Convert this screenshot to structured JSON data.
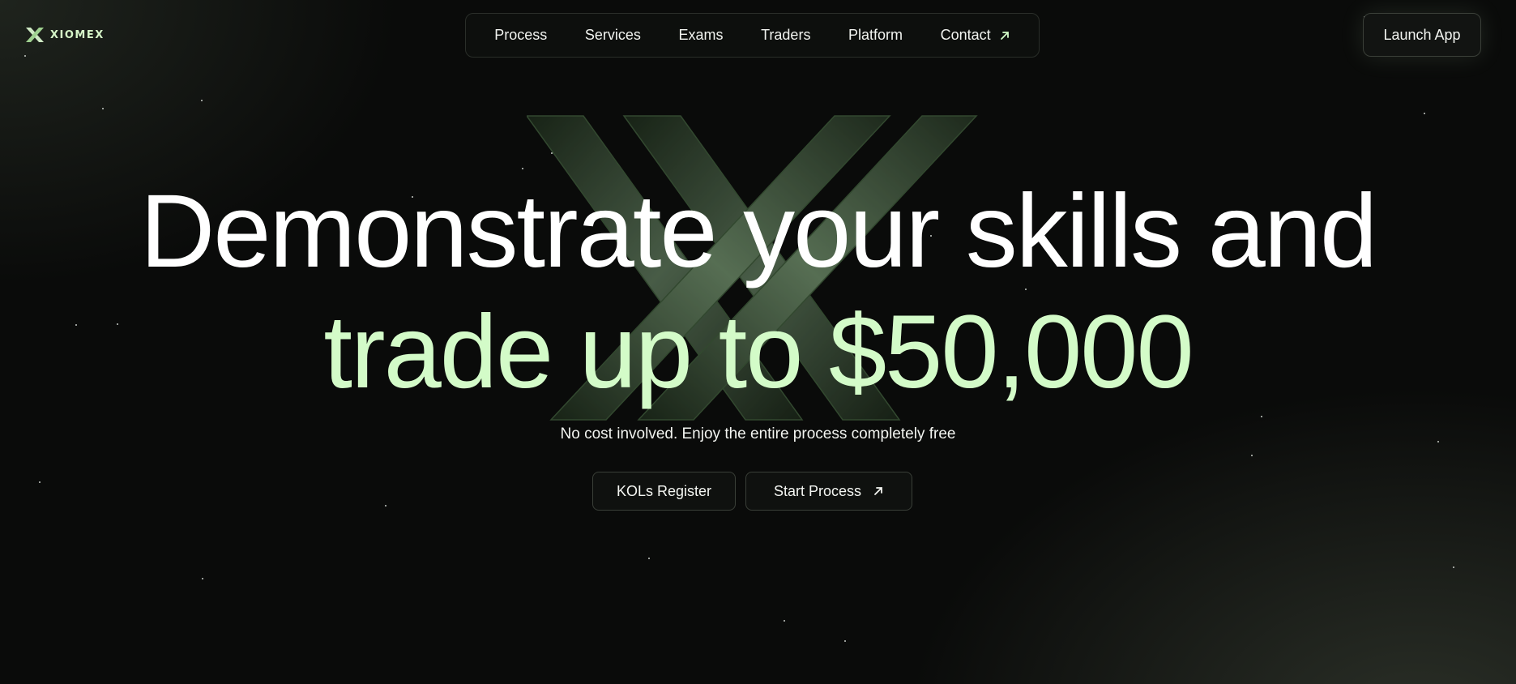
{
  "brand": {
    "name": "XIOMEX",
    "logo_icon": "x-logo-icon",
    "accent_color": "#d3fbc8"
  },
  "nav": {
    "items": [
      {
        "label": "Process"
      },
      {
        "label": "Services"
      },
      {
        "label": "Exams"
      },
      {
        "label": "Traders"
      },
      {
        "label": "Platform"
      },
      {
        "label": "Contact",
        "icon": "arrow-up-right-icon"
      }
    ]
  },
  "header": {
    "launch_label": "Launch App"
  },
  "hero": {
    "headline_line1": "Demonstrate your skills and",
    "headline_line2": "trade up to $50,000",
    "subtitle": "No cost involved. Enjoy the entire process completely free",
    "buttons": [
      {
        "label": "KOLs Register"
      },
      {
        "label": "Start Process",
        "icon": "arrow-up-right-icon"
      }
    ]
  }
}
